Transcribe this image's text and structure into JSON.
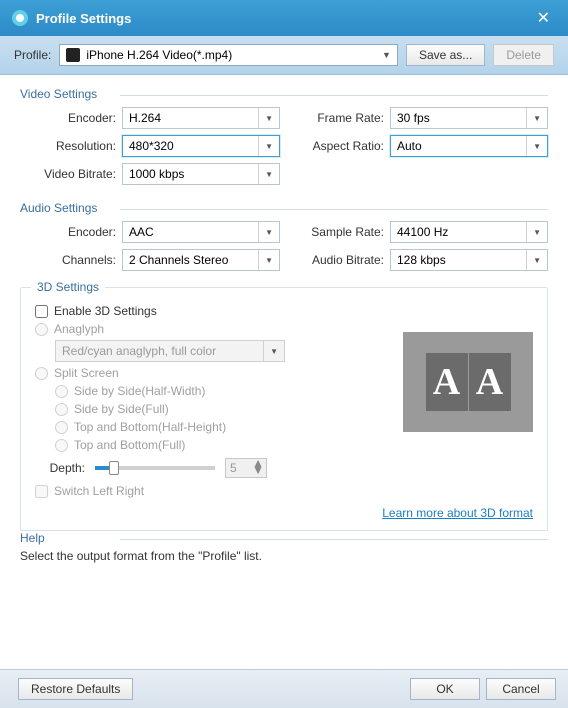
{
  "window": {
    "title": "Profile Settings"
  },
  "profile": {
    "label": "Profile:",
    "value": "iPhone H.264 Video(*.mp4)",
    "save_as": "Save as...",
    "delete": "Delete"
  },
  "video": {
    "legend": "Video Settings",
    "encoder_label": "Encoder:",
    "encoder": "H.264",
    "resolution_label": "Resolution:",
    "resolution": "480*320",
    "bitrate_label": "Video Bitrate:",
    "bitrate": "1000 kbps",
    "framerate_label": "Frame Rate:",
    "framerate": "30 fps",
    "aspect_label": "Aspect Ratio:",
    "aspect": "Auto"
  },
  "audio": {
    "legend": "Audio Settings",
    "encoder_label": "Encoder:",
    "encoder": "AAC",
    "channels_label": "Channels:",
    "channels": "2 Channels Stereo",
    "samplerate_label": "Sample Rate:",
    "samplerate": "44100 Hz",
    "bitrate_label": "Audio Bitrate:",
    "bitrate": "128 kbps"
  },
  "three_d": {
    "legend": "3D Settings",
    "enable": "Enable 3D Settings",
    "anaglyph": "Anaglyph",
    "anaglyph_mode": "Red/cyan anaglyph, full color",
    "split": "Split Screen",
    "sbs_half": "Side by Side(Half-Width)",
    "sbs_full": "Side by Side(Full)",
    "tb_half": "Top and Bottom(Half-Height)",
    "tb_full": "Top and Bottom(Full)",
    "depth_label": "Depth:",
    "depth_value": "5",
    "switch_lr": "Switch Left Right",
    "learn_more": "Learn more about 3D format"
  },
  "help": {
    "legend": "Help",
    "text": "Select the output format from the \"Profile\" list."
  },
  "footer": {
    "restore": "Restore Defaults",
    "ok": "OK",
    "cancel": "Cancel"
  }
}
